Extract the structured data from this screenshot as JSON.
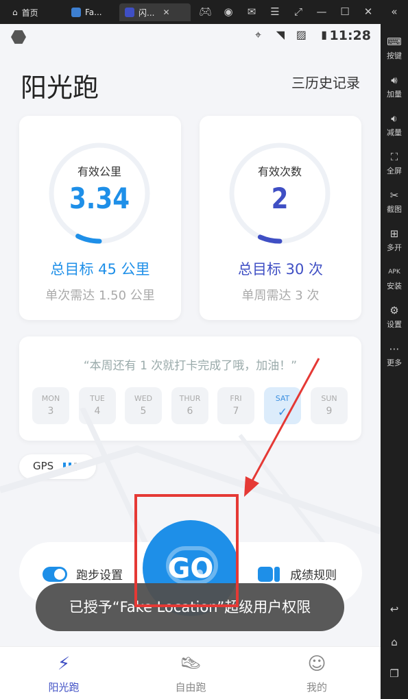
{
  "emulator": {
    "tabs": [
      {
        "label": "首页"
      },
      {
        "label": "Fa..."
      },
      {
        "label": "闪..."
      }
    ],
    "sidebar": [
      {
        "icon": "keyboard-icon",
        "label": "按键"
      },
      {
        "icon": "volume-up-icon",
        "label": "加量"
      },
      {
        "icon": "volume-down-icon",
        "label": "减量"
      },
      {
        "icon": "fullscreen-icon",
        "label": "全屏"
      },
      {
        "icon": "scissors-icon",
        "label": "截图"
      },
      {
        "icon": "multi-open-icon",
        "label": "多开"
      },
      {
        "icon": "apk-icon",
        "label": "安装"
      },
      {
        "icon": "gear-icon",
        "label": "设置"
      },
      {
        "icon": "more-icon",
        "label": "更多"
      }
    ]
  },
  "status_bar": {
    "time": "11:28"
  },
  "app": {
    "title": "阳光跑",
    "history_label": "三历史记录"
  },
  "cards": {
    "distance": {
      "title": "有效公里",
      "value": "3.34",
      "goal": "总目标 45 公里",
      "sub": "单次需达 1.50 公里",
      "progress": 0.074,
      "color": "#1e8fe8"
    },
    "count": {
      "title": "有效次数",
      "value": "2",
      "goal": "总目标 30 次",
      "sub": "单周需达 3 次",
      "progress": 0.067,
      "color": "#3f4fc4"
    }
  },
  "week": {
    "quote": "“本周还有 1 次就打卡完成了哦，加油！”",
    "days": [
      {
        "name": "MON",
        "date": "3",
        "done": false
      },
      {
        "name": "TUE",
        "date": "4",
        "done": false
      },
      {
        "name": "WED",
        "date": "5",
        "done": false
      },
      {
        "name": "THUR",
        "date": "6",
        "done": false
      },
      {
        "name": "FRI",
        "date": "7",
        "done": false
      },
      {
        "name": "SAT",
        "date": "✓",
        "done": true
      },
      {
        "name": "SUN",
        "date": "9",
        "done": false
      }
    ]
  },
  "gps": {
    "label": "GPS"
  },
  "run_panel": {
    "settings_label": "跑步设置",
    "go_label": "GO",
    "rules_label": "成绩规则"
  },
  "toast": {
    "text": "已授予“Fake Location”超级用户权限"
  },
  "nav": [
    {
      "label": "阳光跑",
      "active": true
    },
    {
      "label": "自由跑",
      "active": false
    },
    {
      "label": "我的",
      "active": false
    }
  ]
}
